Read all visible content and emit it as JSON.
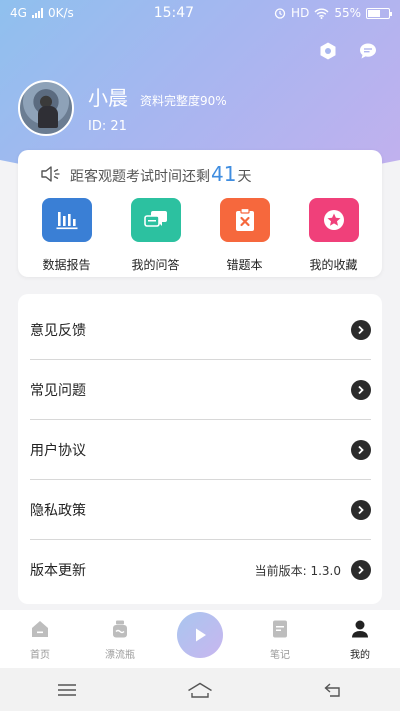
{
  "status_bar": {
    "network": "4G",
    "speed": "0K/s",
    "time": "15:47",
    "hd": "HD",
    "battery": "55%"
  },
  "header": {
    "settings_icon": "hexagon-settings-icon",
    "message_icon": "chat-bubble-icon"
  },
  "profile": {
    "name": "小晨",
    "completeness": "资料完整度90%",
    "id": "ID: 21"
  },
  "notice": {
    "prefix": "距客观题考试时间还剩",
    "days": "41",
    "suffix": "天"
  },
  "features": [
    {
      "label": "数据报告",
      "icon": "bar-chart-icon",
      "color": "#3a7fd5"
    },
    {
      "label": "我的问答",
      "icon": "chat-icon",
      "color": "#2cc1a0"
    },
    {
      "label": "错题本",
      "icon": "clipboard-x-icon",
      "color": "#f6683d"
    },
    {
      "label": "我的收藏",
      "icon": "star-icon",
      "color": "#f0407a"
    }
  ],
  "menu": [
    {
      "label": "意见反馈",
      "value": ""
    },
    {
      "label": "常见问题",
      "value": ""
    },
    {
      "label": "用户协议",
      "value": ""
    },
    {
      "label": "隐私政策",
      "value": ""
    },
    {
      "label": "版本更新",
      "value": "当前版本: 1.3.0"
    }
  ],
  "tabs": [
    {
      "label": "首页",
      "icon": "home-icon",
      "active": false
    },
    {
      "label": "漂流瓶",
      "icon": "bottle-icon",
      "active": false
    },
    {
      "label": "",
      "icon": "play-icon",
      "active": false
    },
    {
      "label": "笔记",
      "icon": "notes-icon",
      "active": false
    },
    {
      "label": "我的",
      "icon": "person-icon",
      "active": true
    }
  ],
  "colors": {
    "accent": "#3f8de0"
  }
}
